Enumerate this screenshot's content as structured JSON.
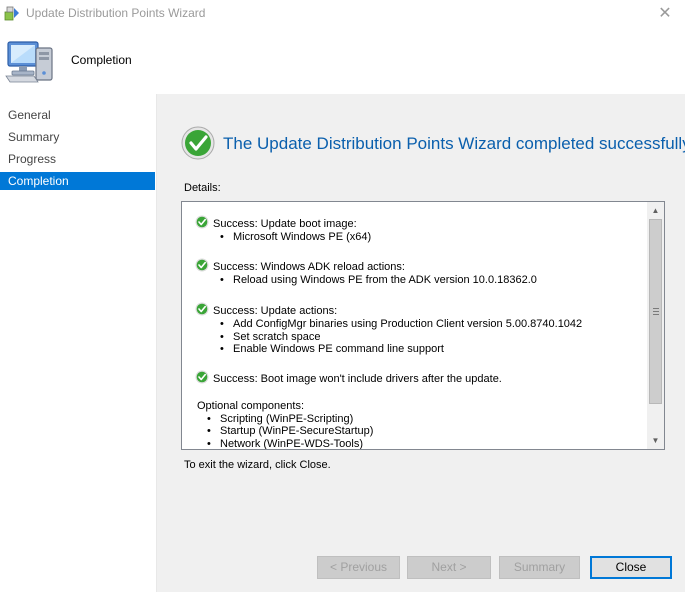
{
  "window": {
    "title": "Update Distribution Points Wizard",
    "close_glyph": "✕"
  },
  "header": {
    "title": "Completion",
    "icon": "computer-icon"
  },
  "nav": {
    "items": [
      {
        "label": "General"
      },
      {
        "label": "Summary"
      },
      {
        "label": "Progress"
      },
      {
        "label": "Completion",
        "active": true
      }
    ]
  },
  "main": {
    "heading": "The Update Distribution Points Wizard completed successfully",
    "details_label": "Details:",
    "entries": [
      {
        "heading": "Success: Update boot image:",
        "items": [
          "Microsoft Windows PE (x64)"
        ]
      },
      {
        "heading": "Success: Windows ADK reload actions:",
        "items": [
          "Reload using Windows PE from the  ADK version 10.0.18362.0"
        ]
      },
      {
        "heading": "Success: Update actions:",
        "items": [
          "Add ConfigMgr binaries using Production Client version 5.00.8740.1042",
          "Set scratch space",
          "Enable Windows PE command line support"
        ]
      },
      {
        "heading": "Success: Boot image won't include drivers after the update.",
        "items": []
      }
    ],
    "optional": {
      "heading": "Optional components:",
      "items": [
        "Scripting (WinPE-Scripting)",
        "Startup (WinPE-SecureStartup)",
        "Network (WinPE-WDS-Tools)"
      ]
    },
    "exit_text": "To exit the wizard, click Close."
  },
  "buttons": {
    "previous": "< Previous",
    "next": "Next >",
    "summary": "Summary",
    "close": "Close"
  },
  "colors": {
    "accent": "#0078d7",
    "heading": "#0a5fad",
    "success": "#3aa537"
  }
}
